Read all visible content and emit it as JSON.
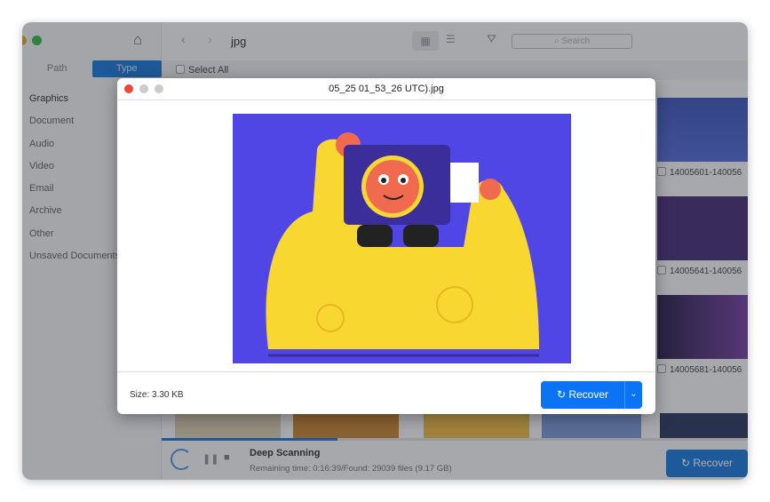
{
  "sidebar": {
    "tabs": [
      "Path",
      "Type"
    ],
    "categories": [
      "Graphics",
      "Document",
      "Audio",
      "Video",
      "Email",
      "Archive",
      "Other",
      "Unsaved Documents"
    ]
  },
  "toolbar": {
    "folder": "jpg",
    "search_placeholder": "Search"
  },
  "select_all": "Select All",
  "thumbnails": [
    {
      "name": "14005601-140056"
    },
    {
      "name": "14005641-140056"
    },
    {
      "name": "14005681-140056"
    }
  ],
  "status": {
    "title": "Deep Scanning",
    "detail": "Remaining time: 0:16:39/Found: 29039 files (9.17 GB)",
    "recover": "Recover",
    "progress_percent": 30
  },
  "modal": {
    "title": "05_25 01_53_26 UTC).jpg",
    "size": "Size: 3.30 KB",
    "recover": "Recover"
  },
  "colors": {
    "accent": "#0a74f5",
    "preview_bg": "#5046e5",
    "figure": "#f7d730"
  }
}
